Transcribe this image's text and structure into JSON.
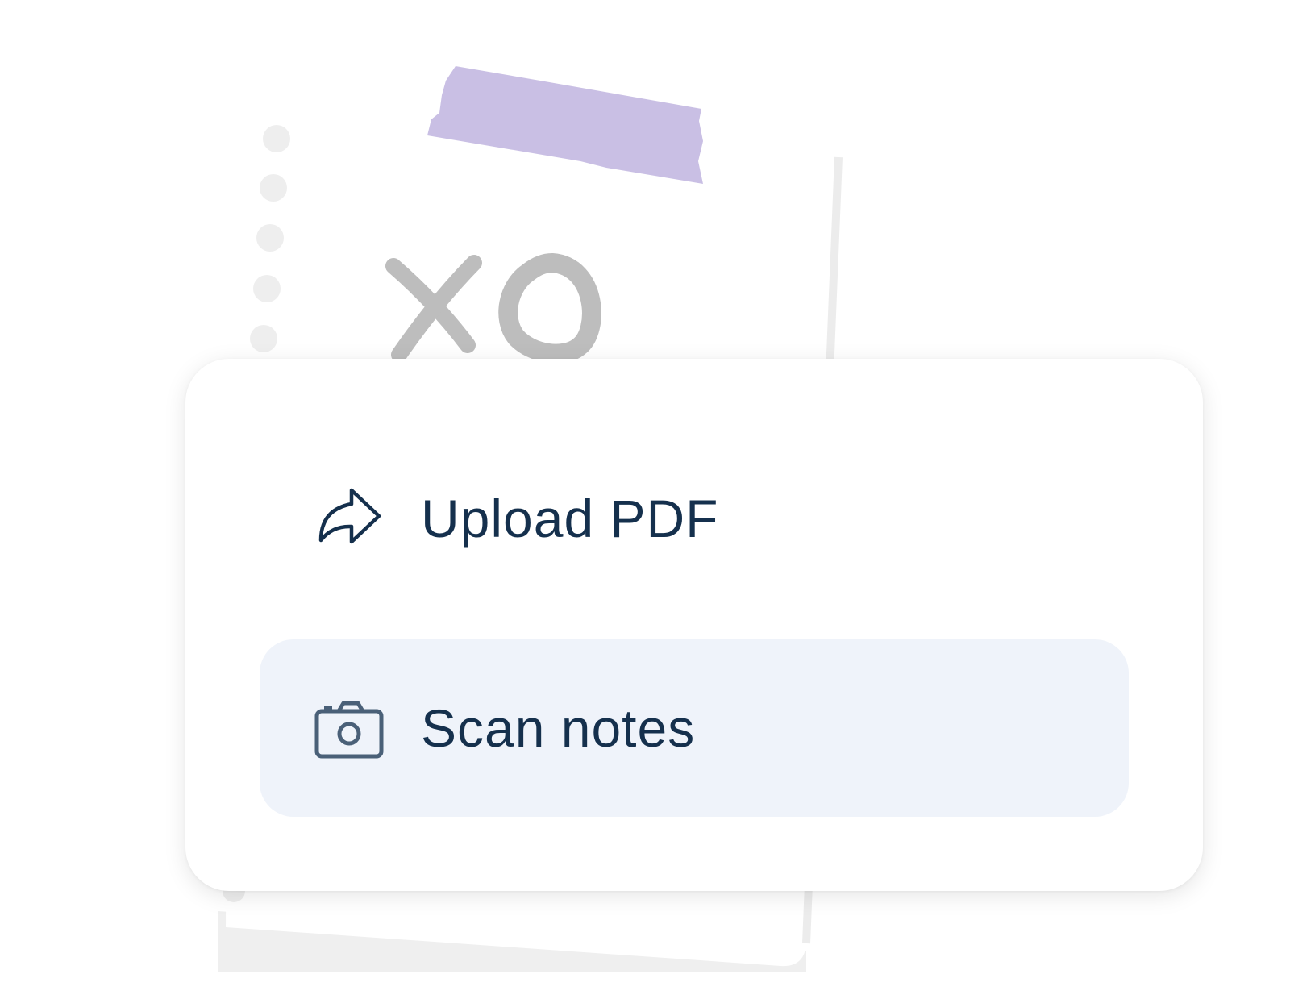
{
  "illustration": {
    "paper_icon": "note-paper-icon",
    "tape_icon": "washi-tape-icon",
    "doodle_text": "XO",
    "tape_color": "#c9bfe4",
    "doodle_color": "#bdbdbd"
  },
  "menu": {
    "items": [
      {
        "label": "Upload PDF",
        "icon": "share-arrow-icon",
        "highlighted": false
      },
      {
        "label": "Scan notes",
        "icon": "camera-icon",
        "highlighted": true
      }
    ],
    "text_color": "#15304d",
    "highlight_color": "#eff3fa"
  }
}
